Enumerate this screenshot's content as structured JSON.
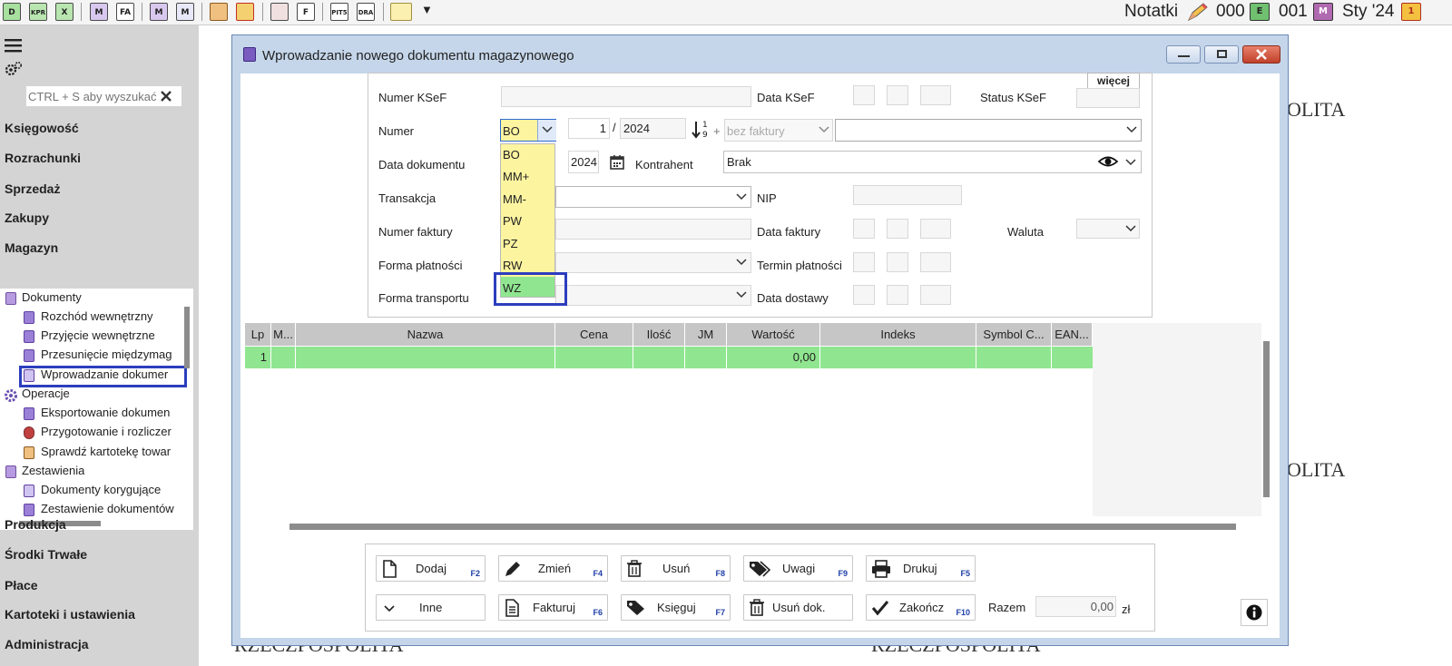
{
  "toolbar": {
    "icons": [
      "D",
      "KPR",
      "X",
      "M",
      "FA",
      "M",
      "M",
      "",
      "",
      "",
      "F",
      "PIT5",
      "DRA",
      "",
      "▼"
    ],
    "notes_label": "Notatki",
    "counter1": "000",
    "counter2": "001",
    "period": "Sty '24",
    "badge1": "E",
    "badge2": "M"
  },
  "sidebar": {
    "search_placeholder": "CTRL + S aby wyszukać",
    "sections": [
      "Księgowość",
      "Rozrachunki",
      "Sprzedaż",
      "Zakupy",
      "Magazyn"
    ],
    "bottom_sections": [
      "Produkcja",
      "Środki Trwałe",
      "Płace",
      "Kartoteki i ustawienia",
      "Administracja"
    ],
    "tree": {
      "documents_group": "Dokumenty",
      "documents": [
        "Rozchód wewnętrzny",
        "Przyjęcie wewnętrzne",
        "Przesunięcie międzymag",
        "Wprowadzanie dokumer"
      ],
      "operations_group": "Operacje",
      "operations": [
        "Eksportowanie dokumen",
        "Przygotowanie i rozliczer",
        "Sprawdź kartotekę towar"
      ],
      "reports_group": "Zestawienia",
      "reports": [
        "Dokumenty korygujące",
        "Zestawienie dokumentów"
      ]
    }
  },
  "background": {
    "text1": "OLITA",
    "text2": "OLITA",
    "text3": "RZECZPOSPOLITA",
    "text4": "RZECZPOSPOLITA"
  },
  "window": {
    "title": "Wprowadzanie nowego dokumentu magazynowego",
    "more_button": "więcej",
    "form": {
      "ksef_number_label": "Numer KSeF",
      "ksef_date_label": "Data KSeF",
      "ksef_status_label": "Status KSeF",
      "number_label": "Numer",
      "number_type": "BO",
      "number_value": "1",
      "number_sep": "/",
      "number_year": "2024",
      "plus": "+",
      "invoice_mode": "bez faktury",
      "doc_date_label": "Data dokumentu",
      "doc_date_year": "2024",
      "contractor_label": "Kontrahent",
      "contractor_value": "Brak",
      "transaction_label": "Transakcja",
      "nip_label": "NIP",
      "invoice_number_label": "Numer faktury",
      "invoice_date_label": "Data faktury",
      "currency_label": "Waluta",
      "payment_form_label": "Forma płatności",
      "payment_term_label": "Termin płatności",
      "transport_form_label": "Forma transportu",
      "delivery_date_label": "Data dostawy"
    },
    "dropdown_options": [
      "BO",
      "MM+",
      "MM-",
      "PW",
      "PZ",
      "RW",
      "WZ"
    ],
    "dropdown_highlight": "WZ",
    "grid": {
      "columns": [
        "Lp",
        "M...",
        "Nazwa",
        "Cena",
        "Ilość",
        "JM",
        "Wartość",
        "Indeks",
        "Symbol C...",
        "EAN..."
      ],
      "rows": [
        {
          "lp": "1",
          "wartosc": "0,00"
        }
      ]
    },
    "buttons": {
      "add": {
        "label": "Dodaj",
        "key": "F2"
      },
      "edit": {
        "label": "Zmień",
        "key": "F4"
      },
      "delete": {
        "label": "Usuń",
        "key": "F8"
      },
      "notes": {
        "label": "Uwagi",
        "key": "F9"
      },
      "print": {
        "label": "Drukuj",
        "key": "F5"
      },
      "other": {
        "label": "Inne"
      },
      "invoice": {
        "label": "Fakturuj",
        "key": "F6"
      },
      "post": {
        "label": "Księguj",
        "key": "F7"
      },
      "delete_doc": {
        "label": "Usuń dok."
      },
      "finish": {
        "label": "Zakończ",
        "key": "F10"
      }
    },
    "total_label": "Razem",
    "total_value": "0,00",
    "currency": "zł"
  },
  "colors": {
    "highlight_green": "#90e690",
    "dropdown_yellow": "#fdf4a0",
    "selection_blue": "#2c3ebd",
    "sidebar_gray": "#d4d4d4"
  }
}
